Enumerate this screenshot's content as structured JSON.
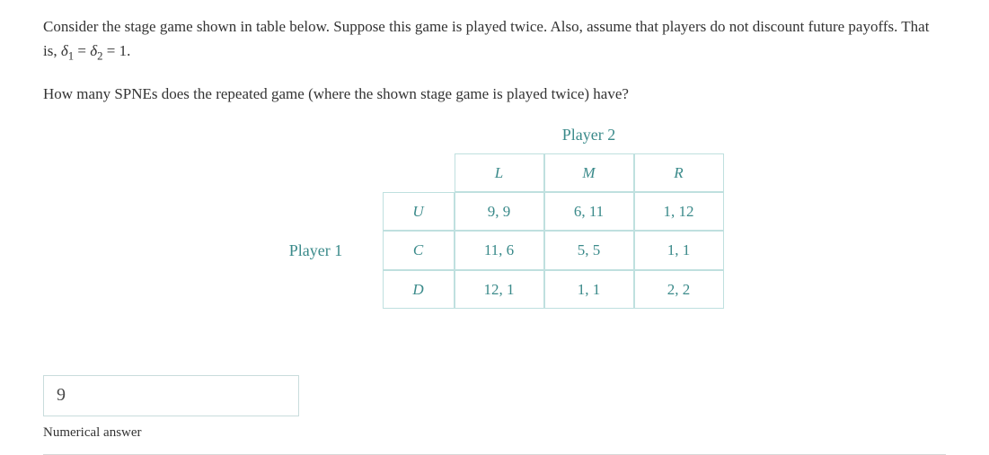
{
  "question": {
    "para1_prefix": "Consider the stage game shown in table below. Suppose this game is played twice. Also, assume that players do not discount future payoffs. That is, ",
    "delta1": "δ",
    "sub1": "1",
    "eq": " = ",
    "delta2": "δ",
    "sub2": "2",
    "eq2": " = 1.",
    "para2": "How many SPNEs does the repeated game (where the shown stage game is played twice) have?"
  },
  "game": {
    "player2_label": "Player 2",
    "player1_label": "Player 1",
    "col_headers": [
      "L",
      "M",
      "R"
    ],
    "row_headers": [
      "U",
      "C",
      "D"
    ],
    "payoffs": [
      [
        "9, 9",
        "6, 11",
        "1, 12"
      ],
      [
        "11, 6",
        "5, 5",
        "1, 1"
      ],
      [
        "12, 1",
        "1, 1",
        "2, 2"
      ]
    ]
  },
  "answer": {
    "value": "9",
    "label": "Numerical answer"
  }
}
